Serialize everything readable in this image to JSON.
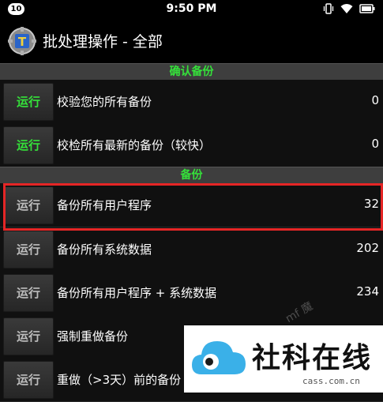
{
  "status_bar": {
    "notification_count": "10",
    "time": "9:50 PM"
  },
  "title_bar": {
    "title": "批处理操作 - 全部"
  },
  "sections": [
    {
      "header": "确认备份",
      "rows": [
        {
          "button": "运行",
          "label": "校验您的所有备份",
          "count": "0"
        },
        {
          "button": "运行",
          "label": "校检所有最新的备份（较快）",
          "count": "0"
        }
      ]
    },
    {
      "header": "备份",
      "rows": [
        {
          "button": "运行",
          "label": "备份所有用户程序",
          "count": "32"
        },
        {
          "button": "运行",
          "label": "备份所有系统数据",
          "count": "202"
        },
        {
          "button": "运行",
          "label": "备份所有用户程序 + 系统数据",
          "count": "234"
        },
        {
          "button": "运行",
          "label": "强制重做备份",
          "count": ""
        },
        {
          "button": "运行",
          "label": "重做（>3天）前的备份",
          "count": ""
        }
      ]
    }
  ],
  "colors": {
    "section_text": "#35e13a",
    "highlight": "#e52626"
  },
  "watermark": {
    "overlay_text": "mf 魔",
    "brand": "社科在线",
    "domain": "cass.com.cn"
  }
}
